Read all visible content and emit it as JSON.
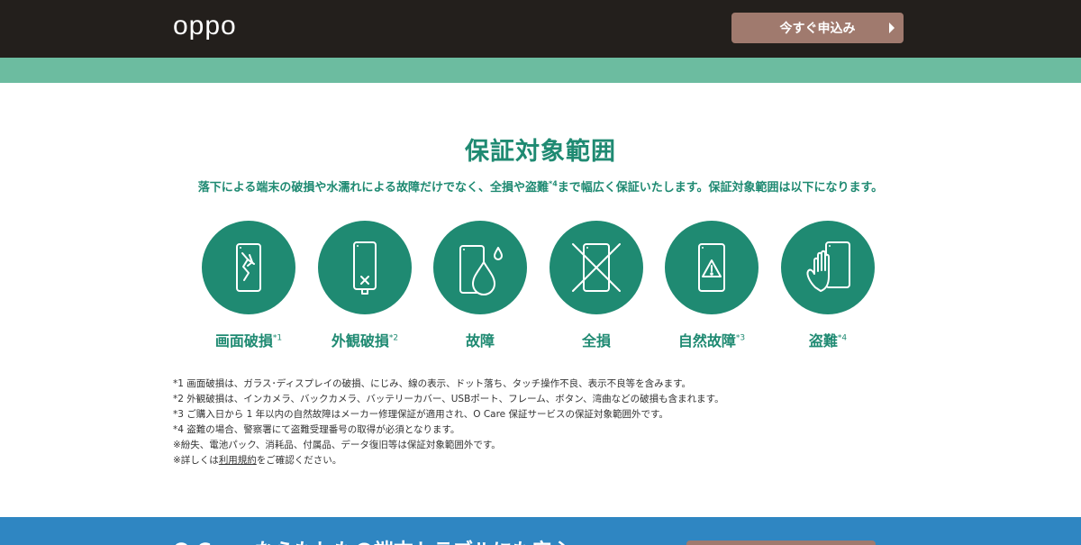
{
  "header": {
    "logo": "oppo",
    "apply_button": "今すぐ申込み"
  },
  "coverage": {
    "title": "保証対象範囲",
    "desc_before": "落下による端末の破損や水濡れによる故障だけでなく、全損や盗難",
    "desc_sup": "*4",
    "desc_after": "まで幅広く保証いたします。保証対象範囲は以下になります。",
    "items": [
      {
        "label": "画面破損",
        "sup": "*1",
        "icon": "cracked-screen-icon"
      },
      {
        "label": "外観破損",
        "sup": "*2",
        "icon": "damaged-exterior-icon"
      },
      {
        "label": "故障",
        "sup": "",
        "icon": "water-damage-icon"
      },
      {
        "label": "全損",
        "sup": "",
        "icon": "total-loss-icon"
      },
      {
        "label": "自然故障",
        "sup": "*3",
        "icon": "warning-phone-icon"
      },
      {
        "label": "盗難",
        "sup": "*4",
        "icon": "theft-hand-icon"
      }
    ],
    "notes": [
      "*1 画面破損は、ガラス･ディスプレイの破損、にじみ、線の表示、ドット落ち、タッチ操作不良、表示不良等を含みます。",
      "*2 外観破損は、インカメラ、バックカメラ、バッテリーカバー、USBポート、フレーム、ボタン、湾曲などの破損も含まれます。",
      "*3 ご購入日から 1 年以内の自然故障はメーカー修理保証が適用され、O Care 保証サービスの保証対象範囲外です。",
      "*4 盗難の場合、警察署にて盗難受理番号の取得が必須となります。",
      "※紛失、電池パック、消耗品、付属品、データ復旧等は保証対象範囲外です。"
    ],
    "last_note_before": "※詳しくは",
    "last_note_link": "利用規約",
    "last_note_after": "をご確認ください。"
  },
  "next_section": {
    "peek_text": "O Care ならもしもの端末トラブルにも安心"
  },
  "colors": {
    "topbar": "#231f1c",
    "accent_green": "#1f8a72",
    "band_green": "#6cbca0",
    "button_brown": "#a07a6e",
    "band_blue": "#2f86c2"
  }
}
